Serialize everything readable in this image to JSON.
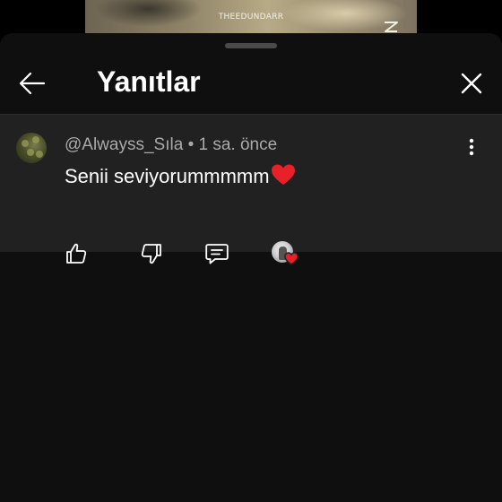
{
  "video": {
    "watermark": "THEEDUNDARR"
  },
  "header": {
    "title": "Yanıtlar",
    "back_icon": "arrow-left-icon",
    "close_icon": "close-icon"
  },
  "comment": {
    "author": "@Alwayss_Sıla",
    "separator": "•",
    "time": "1 sa. önce",
    "text": "Senii seviyorummmmm",
    "emoji": "red-heart-icon",
    "more_icon": "more-vertical-icon"
  },
  "actions": {
    "like_icon": "thumb-up-icon",
    "dislike_icon": "thumb-down-icon",
    "reply_icon": "reply-comment-icon",
    "creator_heart_icon": "creator-heart-icon"
  },
  "colors": {
    "sheet_bg": "#0f0f0f",
    "comment_bg": "#212121",
    "meta_text": "#aaaaaa",
    "heart_red": "#e8202a"
  }
}
